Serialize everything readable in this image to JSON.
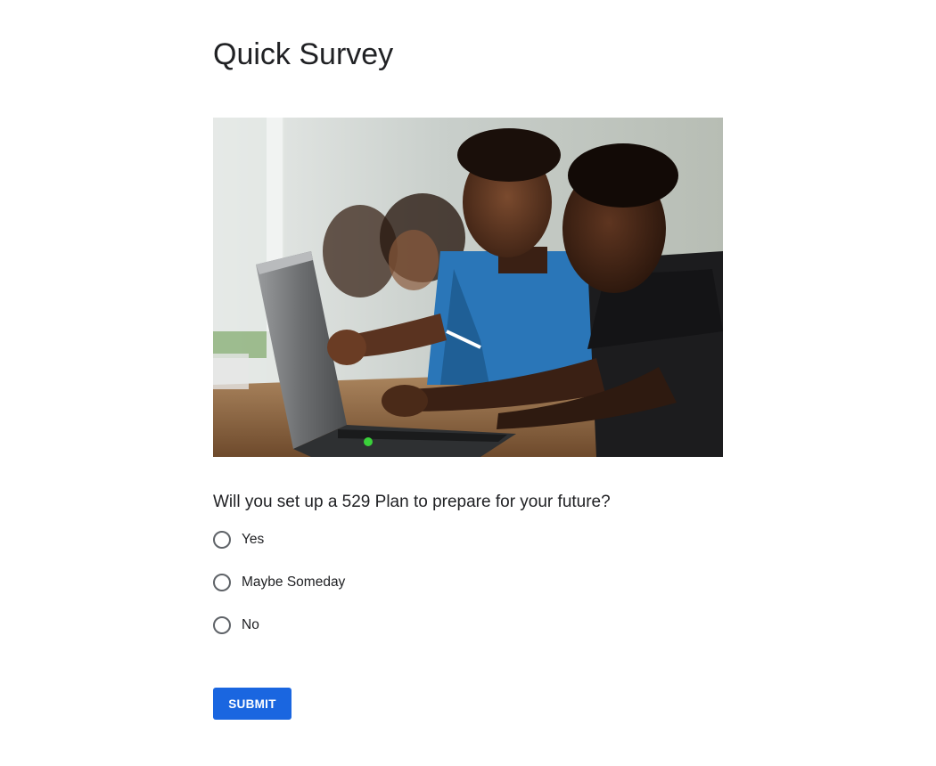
{
  "page": {
    "title": "Quick Survey"
  },
  "hero_image": {
    "description_icon": "students-laptop-photo"
  },
  "survey": {
    "question": "Will you set up a 529 Plan to prepare for your future?",
    "options": [
      {
        "label": "Yes",
        "selected": false
      },
      {
        "label": "Maybe Someday",
        "selected": false
      },
      {
        "label": "No",
        "selected": false
      }
    ],
    "submit_label": "SUBMIT"
  },
  "colors": {
    "accent": "#1a66e0",
    "text": "#202124",
    "radio_border": "#5f6368"
  }
}
